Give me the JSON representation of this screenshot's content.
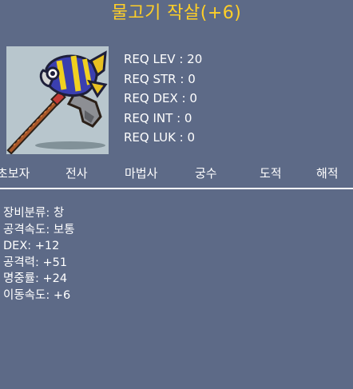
{
  "item": {
    "name": "물고기 작살(+6)",
    "name_color": "#ffcf27"
  },
  "requirements": [
    {
      "label": "REQ LEV",
      "value": "20"
    },
    {
      "label": "REQ STR",
      "value": "0"
    },
    {
      "label": "REQ DEX",
      "value": "0"
    },
    {
      "label": "REQ INT",
      "value": "0"
    },
    {
      "label": "REQ LUK",
      "value": "0"
    }
  ],
  "jobs": [
    {
      "label": "초보자",
      "color": "#ffffff"
    },
    {
      "label": "전사",
      "color": "#ffffff"
    },
    {
      "label": "마법사",
      "color": "#ffffff"
    },
    {
      "label": "궁수",
      "color": "#ffffff"
    },
    {
      "label": "도적",
      "color": "#ffffff"
    },
    {
      "label": "해적",
      "color": "#ffffff"
    }
  ],
  "stats": [
    {
      "label": "장비분류",
      "value": "창"
    },
    {
      "label": "공격속도",
      "value": "보통"
    },
    {
      "label": "DEX",
      "value": "+12"
    },
    {
      "label": "공격력",
      "value": "+51"
    },
    {
      "label": "명중률",
      "value": "+24"
    },
    {
      "label": "이동속도",
      "value": "+6"
    }
  ],
  "icon": "fish-harpoon-icon",
  "colors": {
    "background": "#5d6a87",
    "text": "#ffffff",
    "item_frame": "#b8c6cd"
  }
}
